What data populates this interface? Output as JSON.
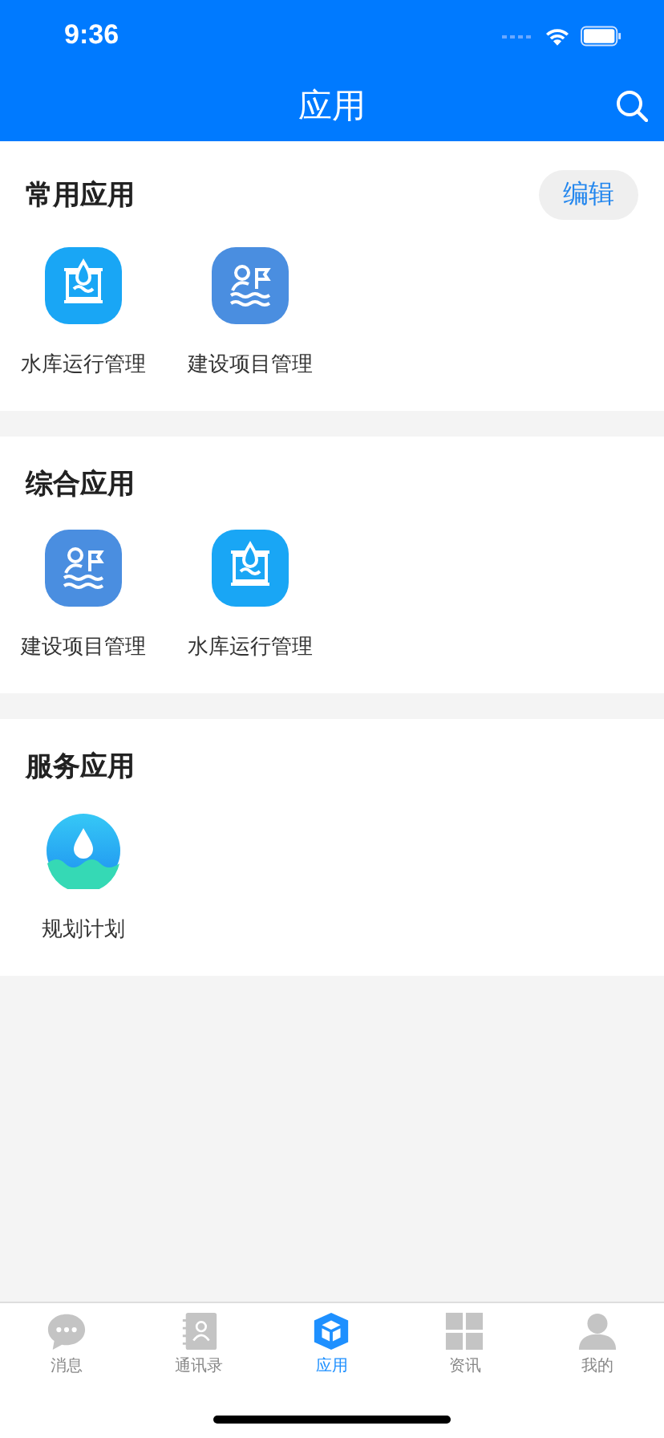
{
  "status_bar": {
    "time": "9:36"
  },
  "nav": {
    "title": "应用"
  },
  "sections": [
    {
      "title": "常用应用",
      "edit_button": "编辑",
      "apps": [
        {
          "kind": "reservoir",
          "label": "水库运行管理"
        },
        {
          "kind": "construction",
          "label": "建设项目管理"
        }
      ]
    },
    {
      "title": "综合应用",
      "apps": [
        {
          "kind": "construction",
          "label": "建设项目管理"
        },
        {
          "kind": "reservoir",
          "label": "水库运行管理"
        }
      ]
    },
    {
      "title": "服务应用",
      "apps": [
        {
          "kind": "planning",
          "label": "规划计划"
        }
      ]
    }
  ],
  "tabs": [
    {
      "kind": "messages",
      "label": "消息",
      "selected": false
    },
    {
      "kind": "contacts",
      "label": "通讯录",
      "selected": false
    },
    {
      "kind": "apps",
      "label": "应用",
      "selected": true
    },
    {
      "kind": "news",
      "label": "资讯",
      "selected": false
    },
    {
      "kind": "profile",
      "label": "我的",
      "selected": false
    }
  ]
}
